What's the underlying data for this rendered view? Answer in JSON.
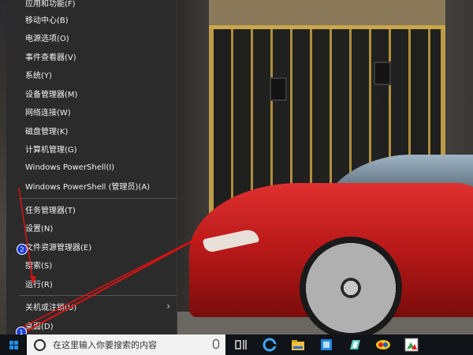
{
  "menu": {
    "items": [
      {
        "label": "应用和功能(F)"
      },
      {
        "label": "移动中心(B)"
      },
      {
        "label": "电源选项(O)"
      },
      {
        "label": "事件查看器(V)"
      },
      {
        "label": "系统(Y)"
      },
      {
        "label": "设备管理器(M)"
      },
      {
        "label": "网络连接(W)"
      },
      {
        "label": "磁盘管理(K)"
      },
      {
        "label": "计算机管理(G)"
      },
      {
        "label": "Windows PowerShell(I)"
      },
      {
        "label": "Windows PowerShell (管理员)(A)"
      },
      {
        "label": "任务管理器(T)"
      },
      {
        "label": "设置(N)"
      },
      {
        "label": "文件资源管理器(E)"
      },
      {
        "label": "搜索(S)"
      },
      {
        "label": "运行(R)"
      },
      {
        "label": "关机或注销(U)"
      },
      {
        "label": "桌面(D)"
      }
    ]
  },
  "annotations": {
    "badge1": "1",
    "badge2": "2",
    "color": "#e01010"
  },
  "taskbar": {
    "search_placeholder": "在这里输入你要搜索的内容",
    "icons": [
      "task-view-icon",
      "edge-icon",
      "file-explorer-icon",
      "store-icon",
      "app-icon",
      "browser-icon",
      "photos-icon"
    ]
  }
}
